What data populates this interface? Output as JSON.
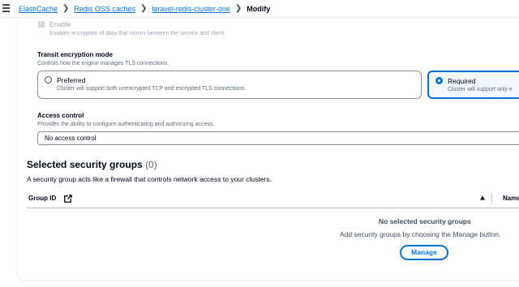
{
  "breadcrumb": {
    "items": [
      "ElastiCache",
      "Redis OSS caches",
      "laravel-redis-cluster-one"
    ],
    "current": "Modify"
  },
  "encryption_in_transit": {
    "checkbox_label": "Enable",
    "checkbox_description": "Enables encryption of data that moves between the service and client.",
    "checked": true,
    "disabled": true
  },
  "transit_mode": {
    "label": "Transit encryption mode",
    "description": "Controls how the engine manages TLS connections.",
    "options": [
      {
        "title": "Preferred",
        "description": "Cluster will support both unencrypted TCP and encrypted TLS connections.",
        "selected": false
      },
      {
        "title": "Required",
        "description": "Cluster will support only e",
        "selected": true
      }
    ]
  },
  "access_control": {
    "label": "Access control",
    "description": "Provides the ability to configure authenticating and authorizing access.",
    "value": "No access control"
  },
  "security_groups": {
    "title": "Selected security groups",
    "count": "(0)",
    "description": "A security group acts like a firewall that controls network access to your clusters.",
    "columns": [
      "Group ID",
      "Name"
    ],
    "empty_title": "No selected security groups",
    "empty_description": "Add security groups by choosing the Manage button.",
    "manage_label": "Manage"
  },
  "colors": {
    "link": "#0972d3",
    "selected_bg": "#f2f8fd",
    "text": "#000716",
    "muted": "#5f6b7a"
  },
  "icons": [
    "menu-icon",
    "chevron-right-icon",
    "checkmark-icon",
    "external-link-icon",
    "sort-ascending-icon"
  ]
}
